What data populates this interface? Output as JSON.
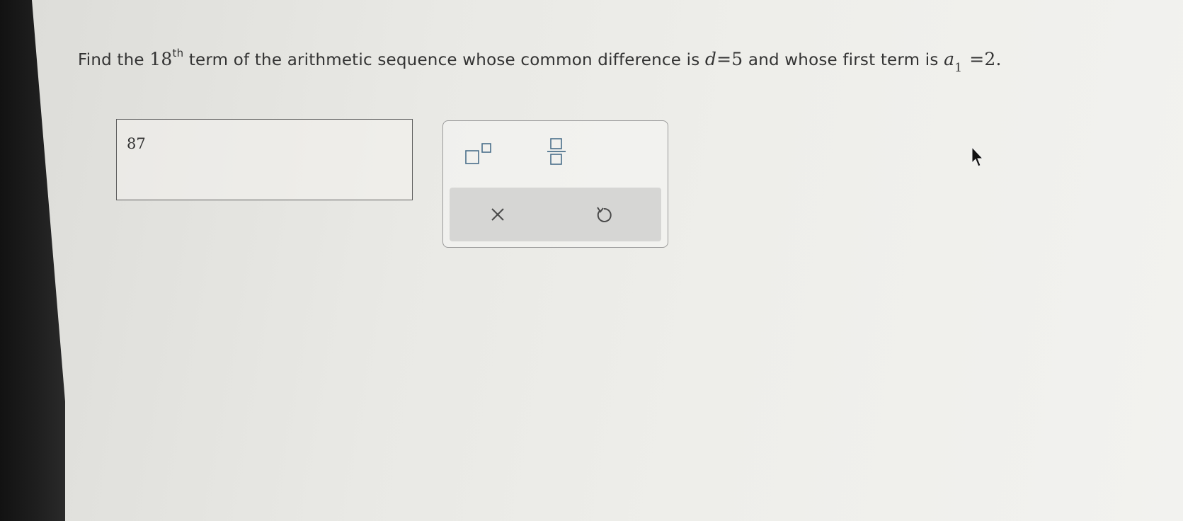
{
  "question": {
    "prefix": "Find the ",
    "term_number": "18",
    "term_suffix": "th",
    "middle": " term of the arithmetic sequence whose common difference is ",
    "d_var": "d",
    "d_eq": "=5",
    "and_text": " and whose first term is ",
    "a_var": "a",
    "a_sub": "1",
    "a_eq": "=2."
  },
  "answer": {
    "value": "87"
  },
  "toolbar": {
    "buttons": [
      {
        "icon": "superscript-template-icon"
      },
      {
        "icon": "fraction-template-icon"
      },
      {
        "icon": "clear-x-icon"
      },
      {
        "icon": "undo-icon"
      }
    ]
  },
  "colors": {
    "text": "#333333",
    "icon_blue": "#4a6f8a",
    "action_bar": "#d6d6d4"
  }
}
